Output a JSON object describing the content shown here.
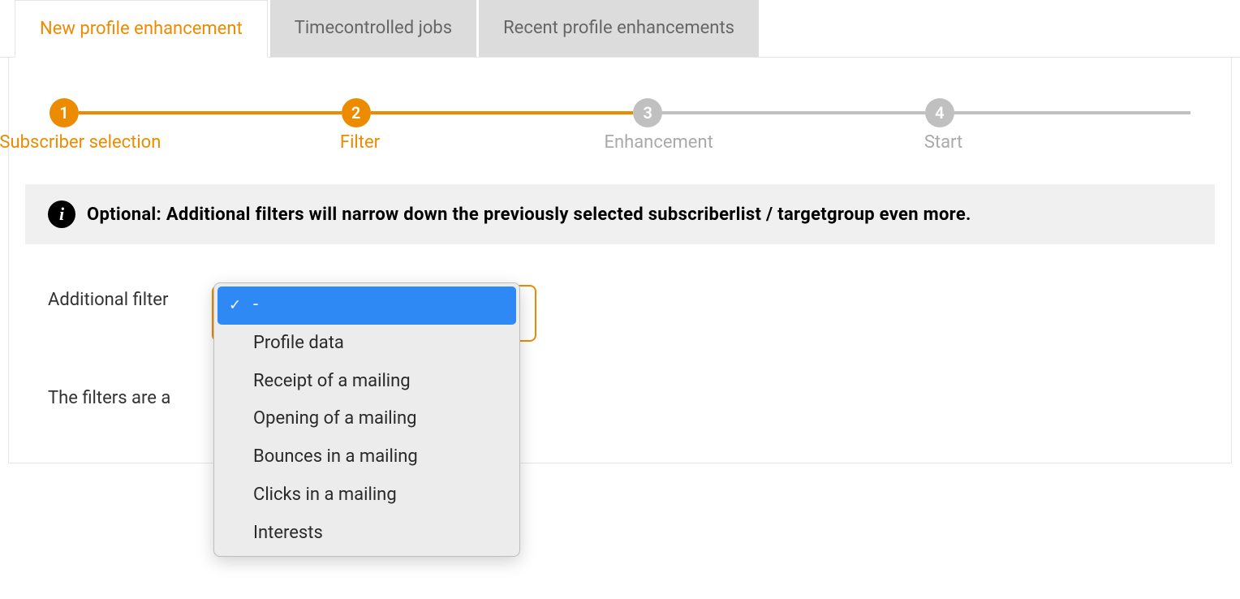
{
  "tabs": [
    {
      "label": "New profile enhancement",
      "active": true
    },
    {
      "label": "Timecontrolled jobs",
      "active": false
    },
    {
      "label": "Recent profile enhancements",
      "active": false
    }
  ],
  "stepper": [
    {
      "num": "1",
      "label": "Subscriber selection",
      "active": true
    },
    {
      "num": "2",
      "label": "Filter",
      "active": true
    },
    {
      "num": "3",
      "label": "Enhancement",
      "active": false
    },
    {
      "num": "4",
      "label": "Start",
      "active": false
    }
  ],
  "info": {
    "text": "Optional: Additional filters will narrow down the previously selected subscriberlist / targetgroup even more."
  },
  "filter": {
    "label": "Additional filter",
    "options": [
      {
        "label": "-",
        "selected": true
      },
      {
        "label": "Profile data",
        "selected": false
      },
      {
        "label": "Receipt of a mailing",
        "selected": false
      },
      {
        "label": "Opening of a mailing",
        "selected": false
      },
      {
        "label": "Bounces in a mailing",
        "selected": false
      },
      {
        "label": "Clicks in a mailing",
        "selected": false
      },
      {
        "label": "Interests",
        "selected": false
      }
    ]
  },
  "applied_text": "The filters are a"
}
